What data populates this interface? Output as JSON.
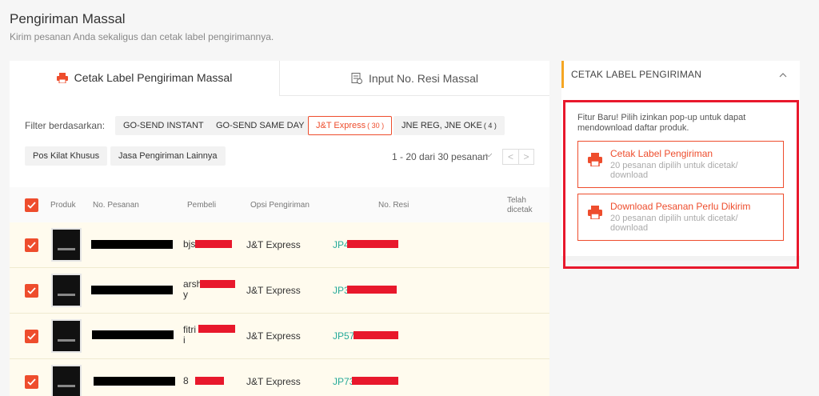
{
  "page": {
    "title": "Pengiriman Massal",
    "subtitle": "Kirim pesanan Anda sekaligus dan cetak label pengirimannya."
  },
  "tabs": [
    {
      "label": "Cetak Label Pengiriman Massal",
      "icon": "printer-icon",
      "active": true
    },
    {
      "label": "Input No. Resi Massal",
      "icon": "document-icon",
      "active": false
    }
  ],
  "filter": {
    "label": "Filter berdasarkan:",
    "chips": [
      {
        "label": "GO-SEND INSTANT",
        "count": ""
      },
      {
        "label": "GO-SEND SAME DAY",
        "count": ""
      },
      {
        "label": "J&T Express",
        "count": "( 30 )",
        "active": true
      },
      {
        "label": "JNE REG, JNE OKE",
        "count": "( 4 )"
      },
      {
        "label": "Pos Kilat Khusus",
        "count": ""
      },
      {
        "label": "Jasa Pengiriman Lainnya",
        "count": ""
      }
    ]
  },
  "pagination": {
    "text": "1 - 20 dari 30 pesanan",
    "chevron": "⌵",
    "prev": "<",
    "next": ">"
  },
  "table": {
    "headers": [
      "Produk",
      "No. Pesanan",
      "Pembeli",
      "Opsi Pengiriman",
      "No. Resi",
      "Telah dicetak"
    ],
    "rows": [
      {
        "buyer": "bjs",
        "buyer_line2": "",
        "shipping": "J&T Express",
        "resi": "JP4"
      },
      {
        "buyer": "arsh",
        "buyer_line2": "y",
        "shipping": "J&T Express",
        "resi": "JP3"
      },
      {
        "buyer": "fitri",
        "buyer_line2": "i",
        "shipping": "J&T Express",
        "resi": "JP57"
      },
      {
        "buyer": "8",
        "buyer_line2": "",
        "shipping": "J&T Express",
        "resi": "JP73"
      }
    ]
  },
  "side_panel": {
    "title": "CETAK LABEL PENGIRIMAN",
    "notice": "Fitur Baru! Pilih izinkan pop-up untuk dapat mendownload daftar produk.",
    "actions": [
      {
        "title": "Cetak Label Pengiriman",
        "desc": "20 pesanan dipilih untuk dicetak/ download"
      },
      {
        "title": "Download Pesanan Perlu Dikirim",
        "desc": "20 pesanan dipilih untuk dicetak/ download"
      }
    ]
  },
  "colors": {
    "accent": "#ee4d2d",
    "resi": "#26aa99",
    "panel_marker": "#f5a623",
    "highlight": "#e8182c"
  }
}
